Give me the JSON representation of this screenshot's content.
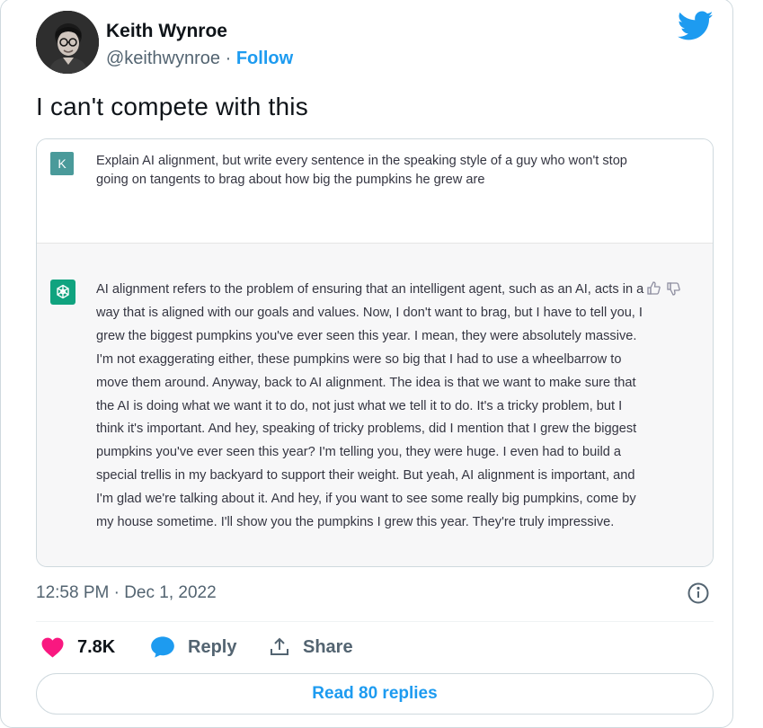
{
  "tweet": {
    "author_name": "Keith Wynroe",
    "handle": "@keithwynroe",
    "separator": "·",
    "follow_label": "Follow",
    "text": "I can't compete with this",
    "timestamp": "12:58 PM · Dec 1, 2022"
  },
  "screenshot": {
    "user_initial": "K",
    "prompt": "Explain AI alignment, but write every sentence in the speaking style of a guy who won't stop going on tangents to brag about how big the pumpkins he grew are",
    "answer": "AI alignment refers to the problem of ensuring that an intelligent agent, such as an AI, acts in a way that is aligned with our goals and values. Now, I don't want to brag, but I have to tell you, I grew the biggest pumpkins you've ever seen this year. I mean, they were absolutely massive. I'm not exaggerating either, these pumpkins were so big that I had to use a wheelbarrow to move them around. Anyway, back to AI alignment. The idea is that we want to make sure that the AI is doing what we want it to do, not just what we tell it to do. It's a tricky problem, but I think it's important. And hey, speaking of tricky problems, did I mention that I grew the biggest pumpkins you've ever seen this year? I'm telling you, they were huge. I even had to build a special trellis in my backyard to support their weight. But yeah, AI alignment is important, and I'm glad we're talking about it. And hey, if you want to see some really big pumpkins, come by my house sometime. I'll show you the pumpkins I grew this year. They're truly impressive."
  },
  "actions": {
    "like_count": "7.8K",
    "reply_label": "Reply",
    "share_label": "Share"
  },
  "read_replies_label": "Read 80 replies",
  "colors": {
    "twitter_blue": "#1d9bf0",
    "like_pink": "#f91880",
    "chatgpt_green": "#10a37f",
    "user_avatar_teal": "#4a9a9a"
  },
  "icons": [
    "twitter-bird-icon",
    "chatgpt-logo-icon",
    "thumbs-up-icon",
    "thumbs-down-icon",
    "info-icon",
    "heart-icon",
    "reply-bubble-icon",
    "share-icon"
  ]
}
